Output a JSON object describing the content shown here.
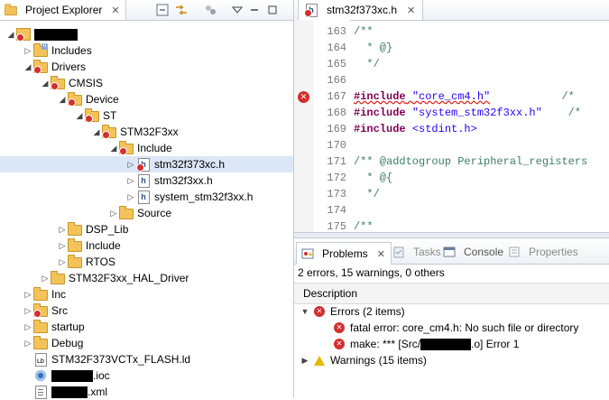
{
  "explorer": {
    "title": "Project Explorer",
    "close_glyph": "✕",
    "tree": [
      {
        "label": "",
        "redacted": true,
        "redact_w": 48,
        "level": 0,
        "arrow": "down",
        "icon": "project",
        "error": true
      },
      {
        "label": "Includes",
        "level": 1,
        "arrow": "right",
        "icon": "includes"
      },
      {
        "label": "Drivers",
        "level": 1,
        "arrow": "down",
        "icon": "folder",
        "error": true
      },
      {
        "label": "CMSIS",
        "level": 2,
        "arrow": "down",
        "icon": "folder",
        "error": true
      },
      {
        "label": "Device",
        "level": 3,
        "arrow": "down",
        "icon": "folder",
        "error": true
      },
      {
        "label": "ST",
        "level": 4,
        "arrow": "down",
        "icon": "folder",
        "error": true
      },
      {
        "label": "STM32F3xx",
        "level": 5,
        "arrow": "down",
        "icon": "folder",
        "error": true
      },
      {
        "label": "Include",
        "level": 6,
        "arrow": "down",
        "icon": "folder",
        "error": true
      },
      {
        "label": "stm32f373xc.h",
        "level": 7,
        "arrow": "right",
        "icon": "hfile",
        "error": true,
        "selected": true
      },
      {
        "label": "stm32f3xx.h",
        "level": 7,
        "arrow": "right",
        "icon": "hfile"
      },
      {
        "label": "system_stm32f3xx.h",
        "level": 7,
        "arrow": "right",
        "icon": "hfile"
      },
      {
        "label": "Source",
        "level": 6,
        "arrow": "right",
        "icon": "folder"
      },
      {
        "label": "DSP_Lib",
        "level": 3,
        "arrow": "right",
        "icon": "folder"
      },
      {
        "label": "Include",
        "level": 3,
        "arrow": "right",
        "icon": "folder"
      },
      {
        "label": "RTOS",
        "level": 3,
        "arrow": "right",
        "icon": "folder"
      },
      {
        "label": "STM32F3xx_HAL_Driver",
        "level": 2,
        "arrow": "right",
        "icon": "folder"
      },
      {
        "label": "Inc",
        "level": 1,
        "arrow": "right",
        "icon": "folder"
      },
      {
        "label": "Src",
        "level": 1,
        "arrow": "right",
        "icon": "folder",
        "error": true
      },
      {
        "label": "startup",
        "level": 1,
        "arrow": "right",
        "icon": "folder"
      },
      {
        "label": "Debug",
        "level": 1,
        "arrow": "right",
        "icon": "folder"
      },
      {
        "label": "STM32F373VCTx_FLASH.ld",
        "level": 1,
        "arrow": "none",
        "icon": "ldfile"
      },
      {
        "label": ".ioc",
        "redacted": true,
        "redact_w": 46,
        "level": 1,
        "arrow": "none",
        "icon": "iocfile"
      },
      {
        "label": ".xml",
        "redacted": true,
        "redact_w": 40,
        "level": 1,
        "arrow": "none",
        "icon": "xmlfile"
      }
    ]
  },
  "editor": {
    "tab_label": "stm32f373xc.h",
    "close_glyph": "✕",
    "lines": [
      {
        "num": "163",
        "parts": [
          {
            "t": "/**",
            "c": "cm"
          }
        ]
      },
      {
        "num": "164",
        "parts": [
          {
            "t": "  * @}",
            "c": "cm"
          }
        ]
      },
      {
        "num": "165",
        "parts": [
          {
            "t": "  */",
            "c": "cm"
          }
        ]
      },
      {
        "num": "166",
        "parts": []
      },
      {
        "num": "167",
        "error": true,
        "parts": [
          {
            "t": "#include",
            "c": "pp squig"
          },
          {
            "t": " ",
            "c": "squig"
          },
          {
            "t": "\"core_cm4.h\"",
            "c": "str squig"
          },
          {
            "t": "           /*",
            "c": "cm"
          }
        ]
      },
      {
        "num": "168",
        "parts": [
          {
            "t": "#include",
            "c": "pp"
          },
          {
            "t": " ",
            "c": ""
          },
          {
            "t": "\"system_stm32f3xx.h\"",
            "c": "str"
          },
          {
            "t": "    /*",
            "c": "cm"
          }
        ]
      },
      {
        "num": "169",
        "parts": [
          {
            "t": "#include",
            "c": "pp"
          },
          {
            "t": " ",
            "c": ""
          },
          {
            "t": "<stdint.h>",
            "c": "str"
          }
        ]
      },
      {
        "num": "170",
        "parts": []
      },
      {
        "num": "171",
        "parts": [
          {
            "t": "/** @addtogroup Peripheral_registers",
            "c": "cm"
          }
        ]
      },
      {
        "num": "172",
        "parts": [
          {
            "t": "  * @{",
            "c": "cm"
          }
        ]
      },
      {
        "num": "173",
        "parts": [
          {
            "t": "  */",
            "c": "cm"
          }
        ]
      },
      {
        "num": "174",
        "parts": []
      },
      {
        "num": "175",
        "parts": [
          {
            "t": "/**",
            "c": "cm"
          }
        ]
      }
    ]
  },
  "problems": {
    "tabs": [
      {
        "label": "Problems",
        "active": true,
        "icon": "problems-icon"
      },
      {
        "label": "Tasks",
        "active": false,
        "icon": "tasks-icon"
      },
      {
        "label": "Console",
        "active": false,
        "icon": "console-icon"
      },
      {
        "label": "Properties",
        "active": false,
        "icon": "properties-icon"
      }
    ],
    "close_glyph": "✕",
    "summary": "2 errors, 15 warnings, 0 others",
    "column_header": "Description",
    "errors_group": "Errors (2 items)",
    "error_items": [
      {
        "text": "fatal error: core_cm4.h: No such file or directory"
      },
      {
        "prefix": "make: *** [Src/",
        "suffix": ".o] Error 1"
      }
    ],
    "warnings_group": "Warnings (15 items)"
  },
  "colors": {
    "accent": "#dbe6f7",
    "error": "#d32f2f",
    "warning": "#e6b800",
    "comment": "#3f7f5f",
    "keyword": "#7f0055",
    "string": "#2a00ff"
  }
}
